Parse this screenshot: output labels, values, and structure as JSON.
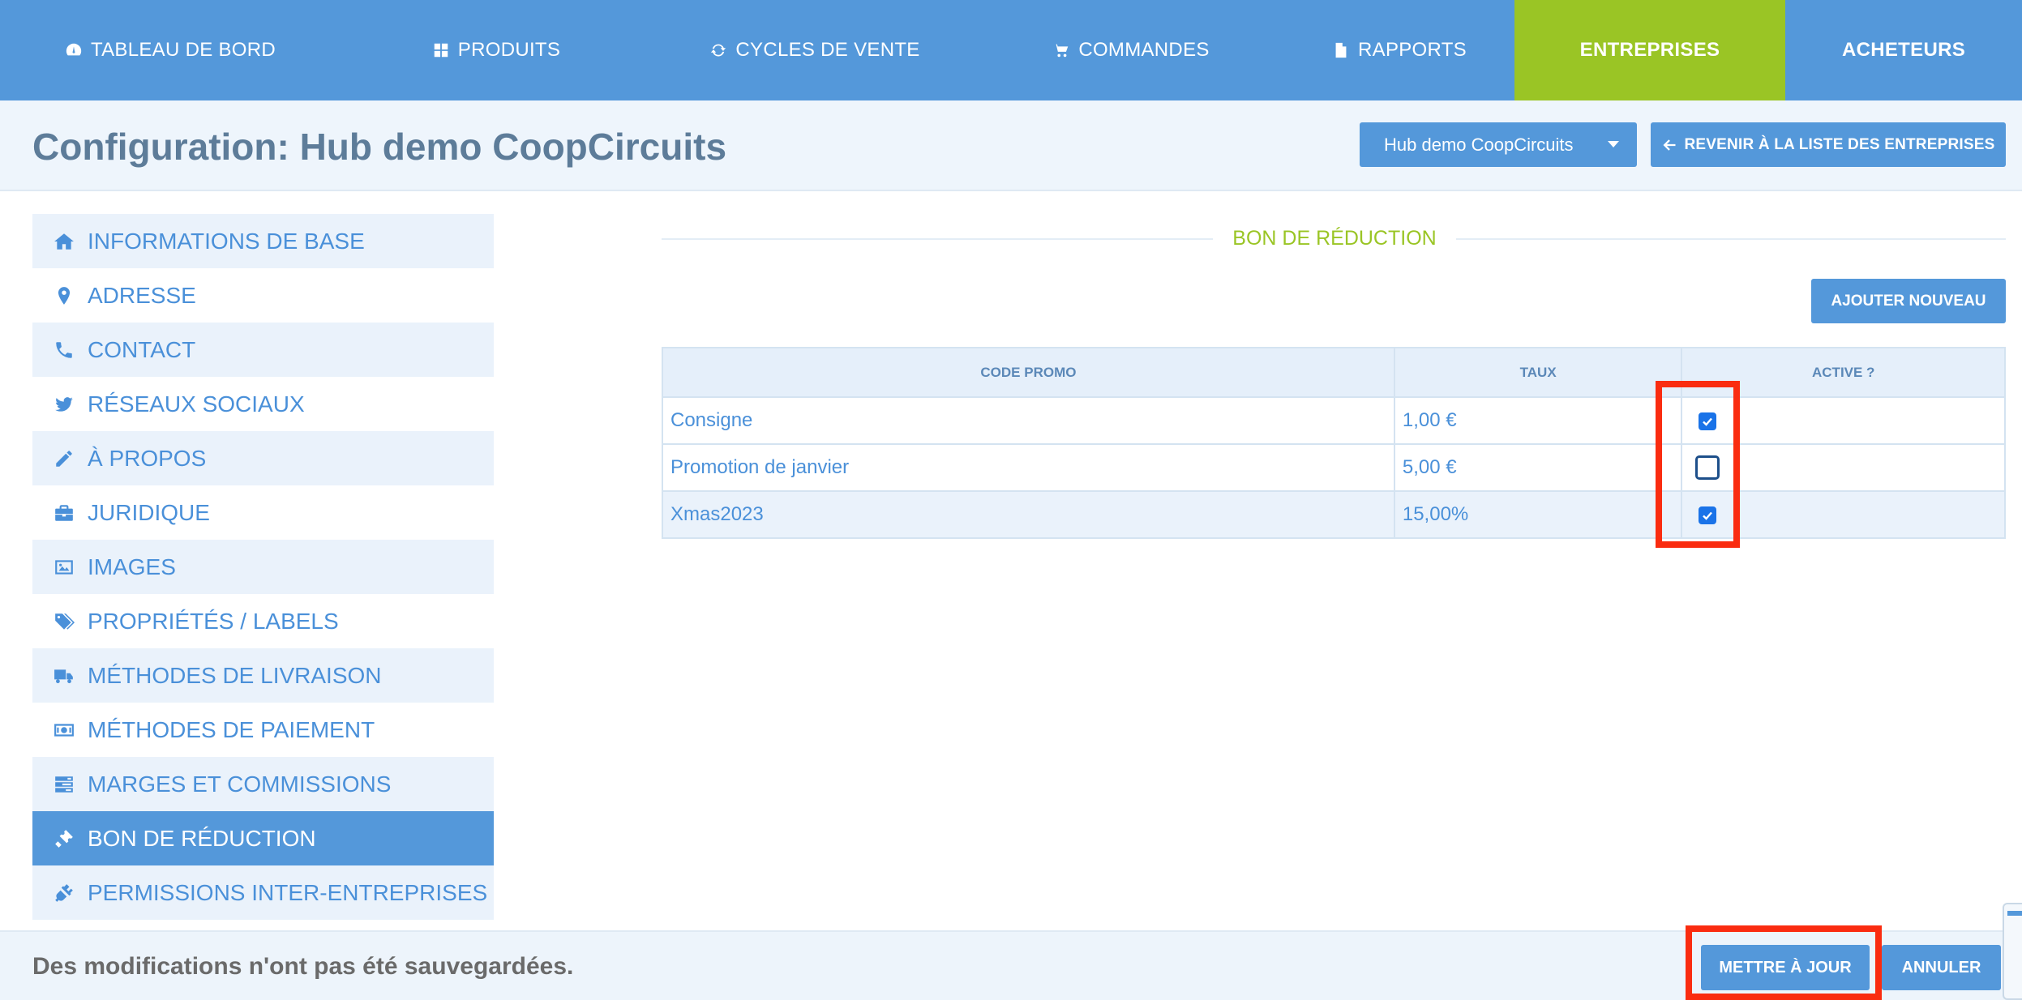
{
  "nav": {
    "items": [
      {
        "label": "TABLEAU DE BORD",
        "icon": "dashboard-icon"
      },
      {
        "label": "PRODUITS",
        "icon": "grid-icon"
      },
      {
        "label": "CYCLES DE VENTE",
        "icon": "refresh-icon"
      },
      {
        "label": "COMMANDES",
        "icon": "cart-icon"
      },
      {
        "label": "RAPPORTS",
        "icon": "file-icon"
      },
      {
        "label": "ENTREPRISES",
        "icon": "",
        "active": true
      },
      {
        "label": "ACHETEURS",
        "icon": ""
      }
    ],
    "colors": {
      "bar": "#5498da",
      "active": "#9ac525"
    }
  },
  "header": {
    "title": "Configuration: Hub demo CoopCircuits",
    "enterprise_select": "Hub demo CoopCircuits",
    "back_button": "REVENIR À LA LISTE DES ENTREPRISES"
  },
  "sidebar": {
    "items": [
      {
        "label": "INFORMATIONS DE BASE",
        "icon": "home-icon"
      },
      {
        "label": "ADRESSE",
        "icon": "map-marker-icon"
      },
      {
        "label": "CONTACT",
        "icon": "phone-icon"
      },
      {
        "label": "RÉSEAUX SOCIAUX",
        "icon": "twitter-icon"
      },
      {
        "label": "À PROPOS",
        "icon": "pencil-icon"
      },
      {
        "label": "JURIDIQUE",
        "icon": "briefcase-icon"
      },
      {
        "label": "IMAGES",
        "icon": "image-icon"
      },
      {
        "label": "PROPRIÉTÉS / LABELS",
        "icon": "tags-icon"
      },
      {
        "label": "MÉTHODES DE LIVRAISON",
        "icon": "truck-icon"
      },
      {
        "label": "MÉTHODES DE PAIEMENT",
        "icon": "money-icon"
      },
      {
        "label": "MARGES ET COMMISSIONS",
        "icon": "tasks-icon"
      },
      {
        "label": "BON DE RÉDUCTION",
        "icon": "ticket-icon",
        "active": true
      },
      {
        "label": "PERMISSIONS INTER-ENTREPRISES",
        "icon": "plug-icon"
      }
    ]
  },
  "section": {
    "title": "BON DE RÉDUCTION",
    "add_button": "AJOUTER NOUVEAU"
  },
  "vouchers": {
    "columns": [
      "CODE PROMO",
      "TAUX",
      "ACTIVE ?"
    ],
    "rows": [
      {
        "code": "Consigne",
        "rate": "1,00 €",
        "active": true
      },
      {
        "code": "Promotion de janvier",
        "rate": "5,00 €",
        "active": false
      },
      {
        "code": "Xmas2023",
        "rate": "15,00%",
        "active": true
      }
    ]
  },
  "footer": {
    "message": "Des modifications n'ont pas été sauvegardées.",
    "update_button": "METTRE À JOUR",
    "cancel_button": "ANNULER"
  },
  "highlight_color": "#fa2c10"
}
